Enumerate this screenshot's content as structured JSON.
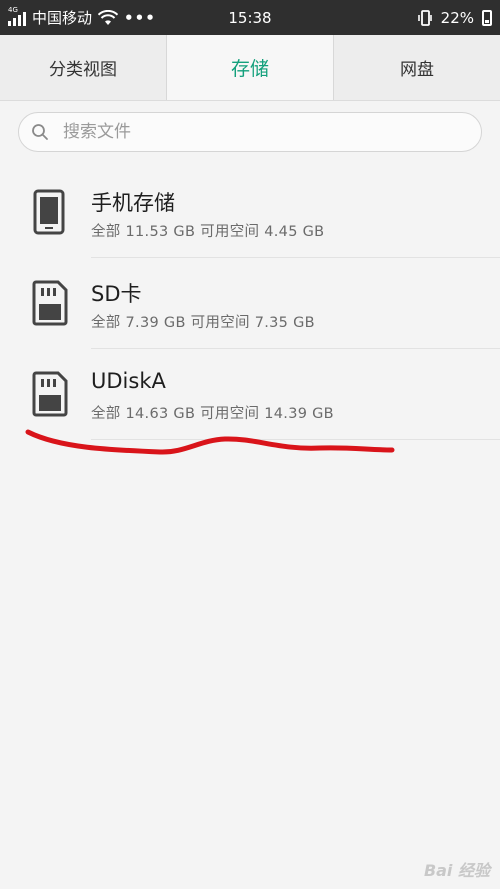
{
  "status_bar": {
    "network_tag": "4G",
    "carrier": "中国移动",
    "more": "•••",
    "time": "15:38",
    "battery": "22%"
  },
  "tabs": [
    {
      "label": "分类视图",
      "active": false
    },
    {
      "label": "存储",
      "active": true
    },
    {
      "label": "网盘",
      "active": false
    }
  ],
  "search": {
    "placeholder": "搜索文件",
    "icon": "search-icon"
  },
  "storage": [
    {
      "name": "手机存储",
      "detail": "全部 11.53 GB 可用空间 4.45 GB",
      "icon": "phone-icon"
    },
    {
      "name": "SD卡",
      "detail": "全部 7.39 GB 可用空间 7.35 GB",
      "icon": "sd-card-icon"
    },
    {
      "name": "UDiskA",
      "detail": "全部 14.63 GB 可用空间 14.39 GB",
      "icon": "sd-card-icon"
    }
  ],
  "watermark": "Bai 经验",
  "colors": {
    "accent": "#13a07c",
    "annotation": "#d9141a",
    "statusbar": "#2f2f2f"
  }
}
